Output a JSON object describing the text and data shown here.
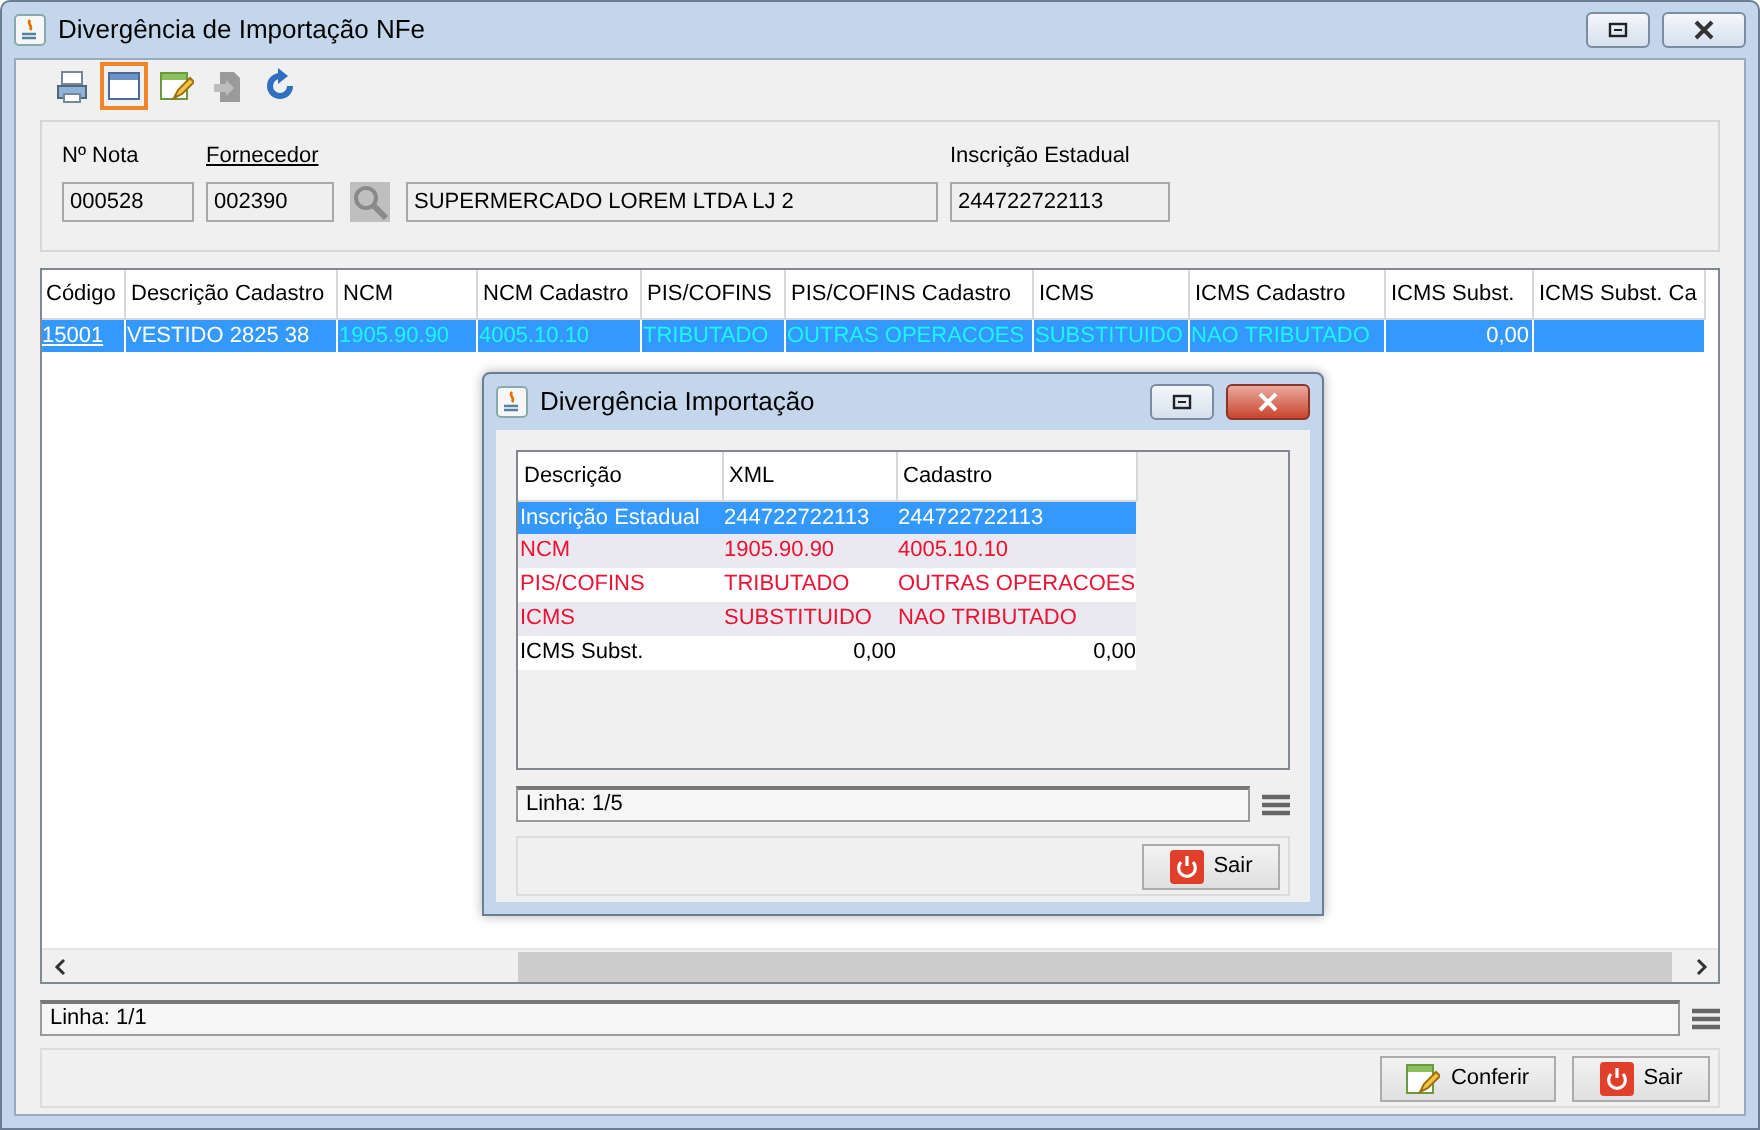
{
  "window": {
    "title": "Divergência de Importação NFe"
  },
  "toolbar": [
    {
      "kind": "print",
      "selected": false
    },
    {
      "kind": "window",
      "selected": true
    },
    {
      "kind": "edit",
      "selected": false
    },
    {
      "kind": "export",
      "selected": false
    },
    {
      "kind": "refresh",
      "selected": false
    }
  ],
  "form": {
    "nota": {
      "label": "Nº Nota",
      "value": "000528"
    },
    "fornecedor": {
      "label": "Fornecedor",
      "code": "002390",
      "name": "SUPERMERCADO LOREM LTDA LJ 2"
    },
    "inscricao": {
      "label": "Inscrição Estadual",
      "value": "244722722113"
    }
  },
  "table": {
    "columns": [
      "Código",
      "Descrição Cadastro",
      "NCM",
      "NCM Cadastro",
      "PIS/COFINS",
      "PIS/COFINS Cadastro",
      "ICMS",
      "ICMS Cadastro",
      "ICMS Subst.",
      "ICMS Subst. Ca"
    ],
    "rows": [
      {
        "selected": true,
        "cells": [
          {
            "text": "15001",
            "divergent": false
          },
          {
            "text": "VESTIDO 2825 38",
            "divergent": false
          },
          {
            "text": "1905.90.90",
            "divergent": true
          },
          {
            "text": "4005.10.10",
            "divergent": true
          },
          {
            "text": "TRIBUTADO",
            "divergent": true
          },
          {
            "text": "OUTRAS OPERACOES",
            "divergent": true
          },
          {
            "text": "SUBSTITUIDO",
            "divergent": true
          },
          {
            "text": "NAO TRIBUTADO",
            "divergent": true
          },
          {
            "text": "0,00",
            "divergent": false
          }
        ]
      }
    ]
  },
  "status": "Linha: 1/1",
  "buttons": [
    {
      "kind": "confirm",
      "label": "Conferir"
    },
    {
      "kind": "exit",
      "label": "Sair"
    }
  ],
  "dialog": {
    "title": "Divergência Importação",
    "columns": [
      "Descrição",
      "XML",
      "Cadastro"
    ],
    "rows": [
      {
        "selected": true,
        "divergent": false,
        "cells": [
          "Inscrição Estadual",
          "244722722113",
          "244722722113"
        ]
      },
      {
        "selected": false,
        "divergent": true,
        "cells": [
          "NCM",
          "1905.90.90",
          "4005.10.10"
        ]
      },
      {
        "selected": false,
        "divergent": true,
        "cells": [
          "PIS/COFINS",
          "TRIBUTADO",
          "OUTRAS OPERACOES"
        ]
      },
      {
        "selected": false,
        "divergent": true,
        "cells": [
          "ICMS",
          "SUBSTITUIDO",
          "NAO TRIBUTADO"
        ]
      },
      {
        "selected": false,
        "divergent": false,
        "cells": [
          "ICMS Subst.",
          "0,00",
          "0,00"
        ]
      }
    ],
    "status": "Linha: 1/5",
    "buttons": [
      {
        "kind": "exit",
        "label": "Sair"
      }
    ]
  }
}
